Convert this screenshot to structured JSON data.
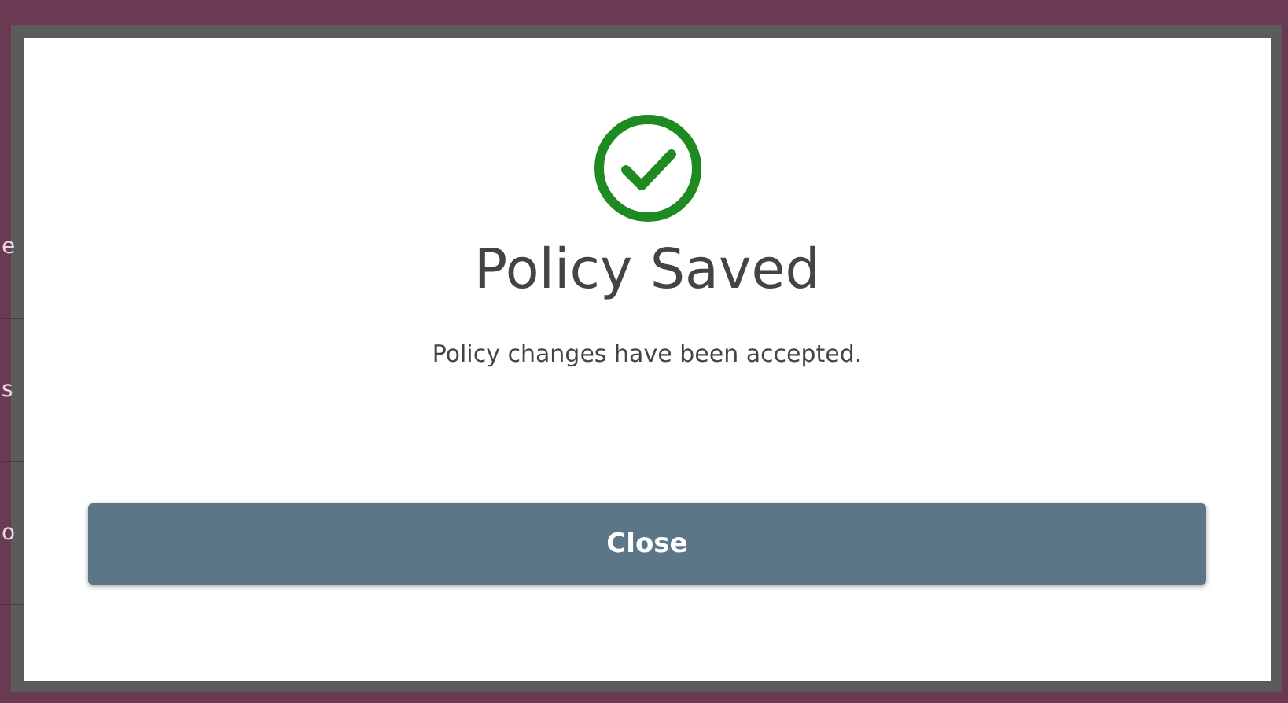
{
  "background": {
    "fragments": [
      "e",
      "s",
      "o"
    ]
  },
  "dialog": {
    "title": "Policy Saved",
    "message": "Policy changes have been accepted.",
    "button": "Close"
  }
}
